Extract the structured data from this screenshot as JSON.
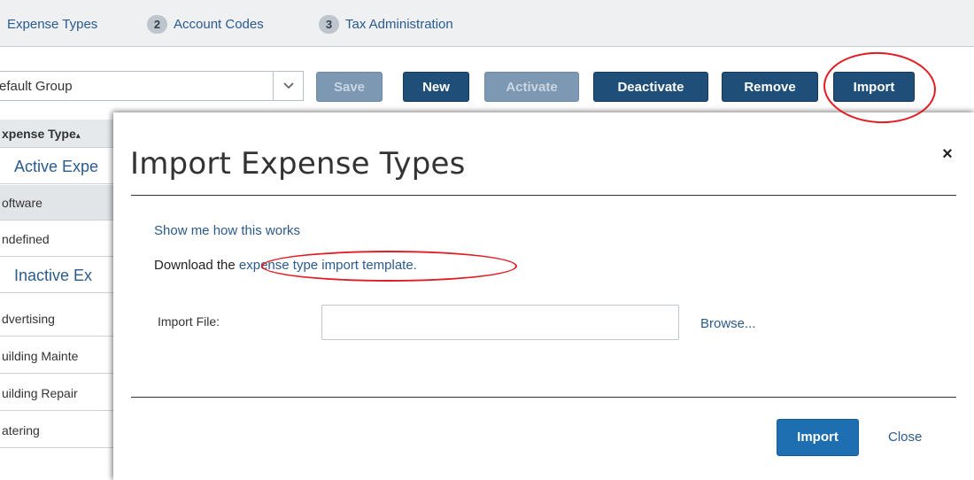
{
  "steps": [
    {
      "label": "Expense Types"
    },
    {
      "number": "2",
      "label": "Account Codes"
    },
    {
      "number": "3",
      "label": "Tax Administration"
    }
  ],
  "toolbar": {
    "group_value": "efault Group",
    "buttons": {
      "save": "Save",
      "new": "New",
      "activate": "Activate",
      "deactivate": "Deactivate",
      "remove": "Remove",
      "import": "Import"
    }
  },
  "list": {
    "header": "xpense Type",
    "sort_indicator": "▴",
    "active_section": "Active Expe",
    "active_rows": [
      "oftware",
      "ndefined"
    ],
    "inactive_section": "Inactive Ex",
    "inactive_rows": [
      "dvertising",
      "uilding Mainte",
      "uilding Repair",
      "atering"
    ]
  },
  "modal": {
    "title": "Import Expense Types",
    "close_symbol": "×",
    "help_link": "Show me how this works",
    "download_prefix": "Download the ",
    "download_link": "expense type import template.",
    "field_label": "Import File:",
    "file_value": "",
    "browse": "Browse...",
    "import_button": "Import",
    "close_link": "Close"
  },
  "colors": {
    "primary_button": "#1f4e79",
    "disabled_button": "#7d98b2",
    "modal_import_button": "#1e6fb2",
    "link": "#2b5a8c",
    "annotation": "#e31b23"
  },
  "icons": {
    "dropdown": "chevron-down-icon",
    "close": "close-icon",
    "sort": "sort-ascending-icon"
  }
}
